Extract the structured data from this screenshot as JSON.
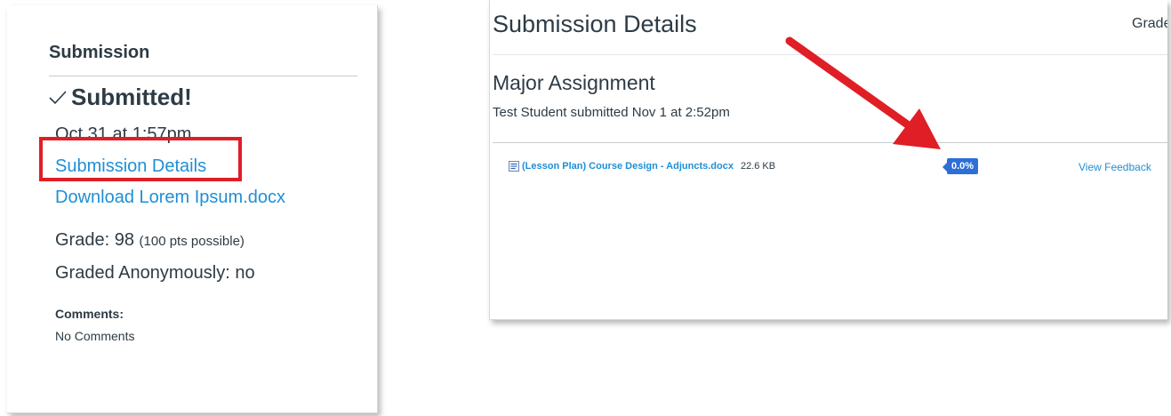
{
  "left": {
    "heading": "Submission",
    "submitted": "Submitted!",
    "date": "Oct 31 at 1:57pm",
    "details_link": "Submission Details",
    "download_link": "Download Lorem Ipsum.docx",
    "grade_prefix": "Grade: 98",
    "grade_possible": "(100 pts possible)",
    "anonymous": "Graded Anonymously: no",
    "comments_heading": "Comments:",
    "comments_value": "No Comments"
  },
  "right": {
    "title": "Submission Details",
    "grade_label": "Grade",
    "assignment": "Major Assignment",
    "submitted_by": "Test Student submitted Nov 1 at 2:52pm",
    "file_name": "(Lesson Plan) Course Design - Adjuncts.docx",
    "file_size": "22.6 KB",
    "score": "0.0%",
    "view_feedback": "View Feedback"
  },
  "colors": {
    "link": "#1e8fd6",
    "highlight": "#e01e26",
    "badge": "#2d6fd6",
    "arrow": "#e01e26"
  },
  "icons": {
    "check": "check-icon",
    "document": "document-icon",
    "arrow": "red-arrow-annotation"
  }
}
